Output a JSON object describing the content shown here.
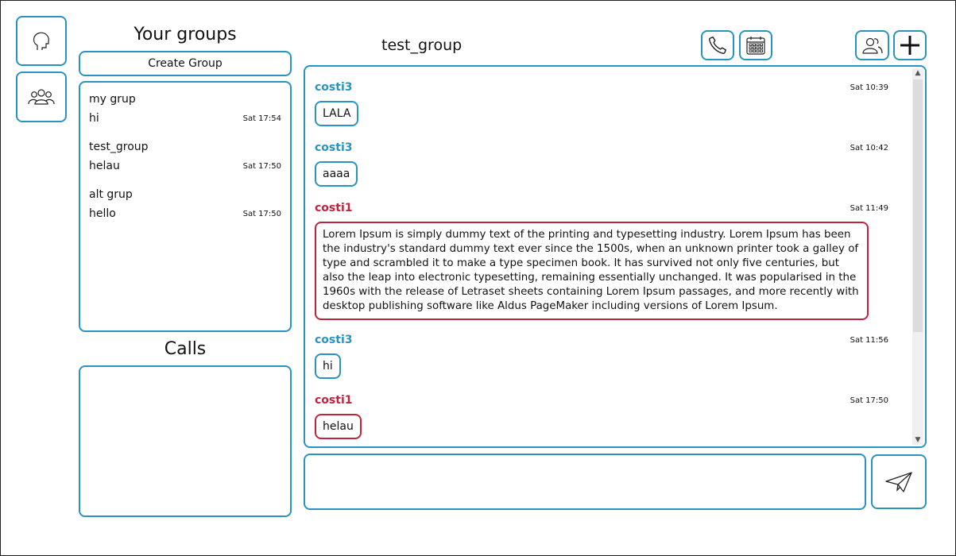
{
  "nav": {
    "items": [
      {
        "icon": "head-icon"
      },
      {
        "icon": "people-icon"
      }
    ]
  },
  "groups": {
    "title": "Your groups",
    "create_label": "Create Group",
    "items": [
      {
        "name": "my grup",
        "last": "hi",
        "time": "Sat 17:54"
      },
      {
        "name": "test_group",
        "last": "helau",
        "time": "Sat 17:50"
      },
      {
        "name": "alt grup",
        "last": "hello",
        "time": "Sat 17:50"
      }
    ]
  },
  "calls": {
    "title": "Calls"
  },
  "chat": {
    "title": "test_group",
    "messages": [
      {
        "sender": "costi3",
        "time": "Sat 10:39",
        "text": "LALA"
      },
      {
        "sender": "costi3",
        "time": "Sat 10:42",
        "text": "aaaa"
      },
      {
        "sender": "costi1",
        "time": "Sat 11:49",
        "text": "Lorem Ipsum is simply dummy text of the printing and typesetting industry. Lorem Ipsum has been the industry's standard dummy text ever since the 1500s, when an unknown printer took a galley of type and scrambled it to make a type specimen book. It has survived not only five centuries, but also the leap into electronic typesetting, remaining essentially unchanged. It was popularised in the 1960s with the release of Letraset sheets containing Lorem Ipsum passages, and more recently with desktop publishing software like Aldus PageMaker including versions of Lorem Ipsum."
      },
      {
        "sender": "costi3",
        "time": "Sat 11:56",
        "text": "hi"
      },
      {
        "sender": "costi1",
        "time": "Sat 17:50",
        "text": "helau"
      }
    ]
  },
  "composer": {
    "value": "",
    "placeholder": ""
  },
  "colors": {
    "accent": "#2a93bf",
    "other_user": "#c0243d"
  }
}
